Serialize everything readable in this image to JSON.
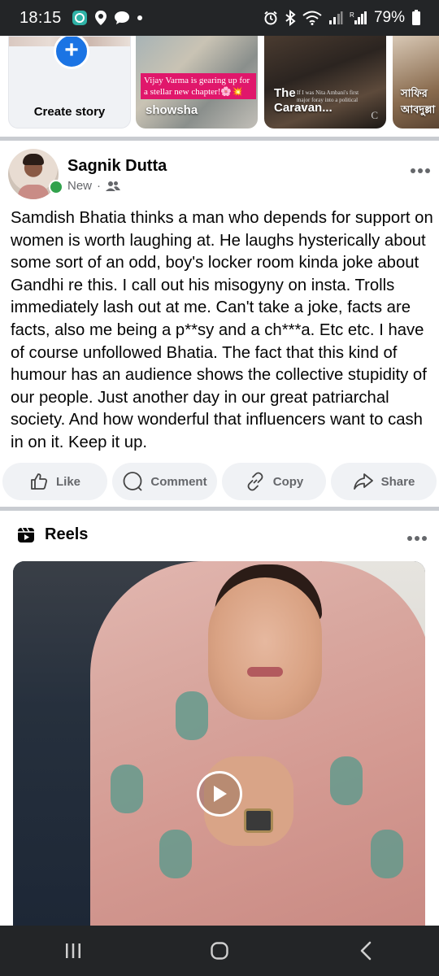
{
  "status_bar": {
    "time": "18:15",
    "battery": "79%",
    "icons": [
      "app-notification-icon",
      "location-icon",
      "chat-icon",
      "dot-icon",
      "alarm-icon",
      "bluetooth-icon",
      "wifi-icon",
      "signal-icon",
      "signal-r-icon",
      "battery-icon"
    ]
  },
  "stories": {
    "create_label": "Create story",
    "items": [
      {
        "name": "showsha",
        "caption": "Vijay Varma is gearing up for a stellar new chapter!🌸💥"
      },
      {
        "name": "The Caravan...",
        "overlay_title": "The",
        "overlay_title2": "Caravan...",
        "small_text": "If I was Nita Ambani's first major foray into a political rally",
        "corner_letter": "C"
      },
      {
        "name": "সাফির আবদুল্লা",
        "line1": "সাফির",
        "line2": "আবদুল্লা"
      }
    ]
  },
  "post": {
    "author": "Sagnik Dutta",
    "meta": "New",
    "meta_separator": "·",
    "text": "Samdish Bhatia thinks a man who depends for support on women is worth laughing at. He laughs hysterically about some sort of an odd, boy's locker room kinda joke about Gandhi re this. I call out his misogyny on insta. Trolls immediately lash out at me. Can't take a joke, facts are facts, also me being a p**sy and a ch***a. Etc etc. I have of course unfollowed Bhatia. The fact that this kind of humour has an audience shows the collective stupidity of our people. Just another day in our great patriarchal society. And how wonderful that influencers want to cash in on it. Keep it up.",
    "actions": {
      "like": "Like",
      "comment": "Comment",
      "copy": "Copy",
      "share": "Share"
    }
  },
  "reels": {
    "title": "Reels"
  },
  "colors": {
    "accent": "#1b74e4",
    "online": "#31a24c",
    "secondary_text": "#65676b",
    "button_bg": "#f0f2f5",
    "system_bar": "#232527"
  }
}
